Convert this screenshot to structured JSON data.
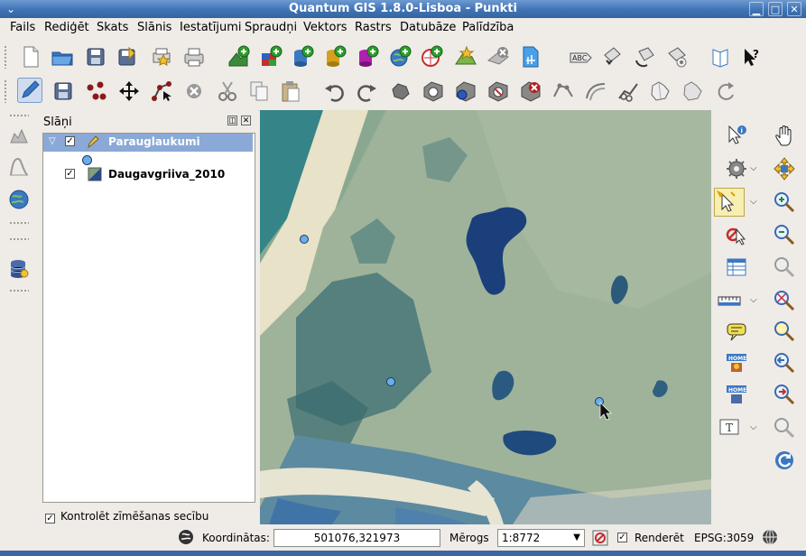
{
  "window": {
    "title": "Quantum GIS 1.8.0-Lisboa - Punkti"
  },
  "menubar": {
    "items": [
      "Fails",
      "Rediģēt",
      "Skats",
      "Slānis",
      "Iestatījumi",
      "Spraudņi",
      "Vektors",
      "Rastrs",
      "Datubāze",
      "Palīdzība"
    ]
  },
  "toolbar1": {
    "icons": [
      "new-project-icon",
      "open-project-icon",
      "save-project-icon",
      "save-as-icon",
      "new-print-composer-icon",
      "print-icon",
      "add-vector-layer-icon",
      "add-raster-layer-icon",
      "add-postgis-layer-icon",
      "add-spatialite-layer-icon",
      "add-mssql-layer-icon",
      "add-wms-layer-icon",
      "add-wfs-layer-icon",
      "new-shapefile-icon",
      "remove-layer-icon",
      "new-spatialite-layer-icon",
      "label-icon",
      "move-label-icon",
      "rotate-label-icon",
      "change-label-icon",
      "help-book-icon",
      "whats-this-icon"
    ]
  },
  "toolbar2": {
    "icons": [
      "toggle-editing-icon",
      "save-edits-icon",
      "add-feature-icon",
      "move-feature-icon",
      "node-tool-icon",
      "delete-selected-icon",
      "cut-features-icon",
      "copy-features-icon",
      "paste-features-icon",
      "undo-icon",
      "redo-icon",
      "simplify-feature-icon",
      "add-ring-icon",
      "add-part-icon",
      "delete-ring-icon",
      "delete-part-icon",
      "reshape-features-icon",
      "offset-curve-icon",
      "split-features-icon",
      "merge-features-icon",
      "merge-attributes-icon",
      "rotate-point-symbols-icon"
    ]
  },
  "layers_panel": {
    "title": "Slāņi",
    "layers": [
      {
        "name": "Parauglaukumi",
        "checked": true,
        "selected": true
      },
      {
        "name": "Daugavgriiva_2010",
        "checked": true,
        "selected": false
      }
    ],
    "render_order_label": "Kontrolēt zīmēšanas secību"
  },
  "map": {
    "points": 3
  },
  "status": {
    "coordinates_label": "Koordinātas:",
    "coordinates_value": "501076,321973",
    "scale_label": "Mērogs",
    "scale_value": "1:8772",
    "render_label": "Renderēt",
    "crs": "EPSG:3059"
  },
  "colors": {
    "titlebar": "#3f73b5",
    "selection": "#8aa9d6",
    "point_fill": "#6aaee8"
  }
}
